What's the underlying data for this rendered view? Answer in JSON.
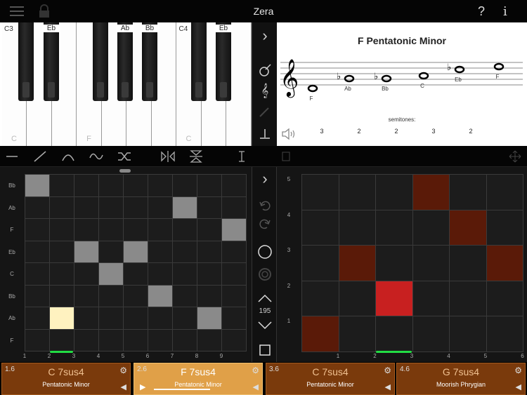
{
  "app": {
    "title": "Zera"
  },
  "piano": {
    "white_keys": [
      {
        "bottom": "C",
        "top": "C3"
      },
      {
        "bottom": "",
        "top": ""
      },
      {
        "bottom": "",
        "top": ""
      },
      {
        "bottom": "F",
        "top": ""
      },
      {
        "bottom": "",
        "top": ""
      },
      {
        "bottom": "",
        "top": ""
      },
      {
        "bottom": "",
        "top": ""
      },
      {
        "bottom": "C",
        "top": "C4"
      },
      {
        "bottom": "",
        "top": ""
      },
      {
        "bottom": "",
        "top": ""
      }
    ],
    "black_keys": [
      {
        "label": ""
      },
      {
        "label": "Eb"
      },
      {
        "label": ""
      },
      {
        "label": "Ab"
      },
      {
        "label": "Bb"
      },
      {
        "label": ""
      },
      {
        "label": "Eb"
      }
    ]
  },
  "staff": {
    "title": "F  Pentatonic Minor",
    "notes": [
      "F",
      "Ab",
      "Bb",
      "C",
      "Eb",
      "F"
    ],
    "semitones_label": "semitones:",
    "semitones": [
      "3",
      "2",
      "2",
      "3",
      "2"
    ]
  },
  "left_grid": {
    "y_labels": [
      "Bb",
      "Ab",
      "F",
      "Eb",
      "C",
      "Bb",
      "Ab",
      "F"
    ],
    "x_labels": [
      "1",
      "2",
      "3",
      "4",
      "5",
      "6",
      "7",
      "8",
      "9"
    ]
  },
  "right_grid": {
    "y_labels": [
      "5",
      "4",
      "3",
      "2",
      "1"
    ],
    "x_labels": [
      "1",
      "2",
      "3",
      "4",
      "5",
      "6"
    ]
  },
  "controls": {
    "tempo": "195"
  },
  "cards": [
    {
      "num": "1.6",
      "chord": "C 7sus4",
      "scale": "Pentatonic Minor"
    },
    {
      "num": "2.6",
      "chord": "F 7sus4",
      "scale": "Pentatonic Minor"
    },
    {
      "num": "3.6",
      "chord": "C 7sus4",
      "scale": "Pentatonic Minor"
    },
    {
      "num": "4.6",
      "chord": "G 7sus4",
      "scale": "Moorish Phrygian"
    }
  ],
  "colors": {
    "card_bg": "#7a3a0c",
    "card_active_bg": "#e0a048",
    "grid_gray": "#8a8a8a",
    "grid_highlight": "#fff2c0",
    "right_dark_red": "#5a1a08",
    "right_red": "#c82020",
    "playhead_green": "#22dd44"
  }
}
